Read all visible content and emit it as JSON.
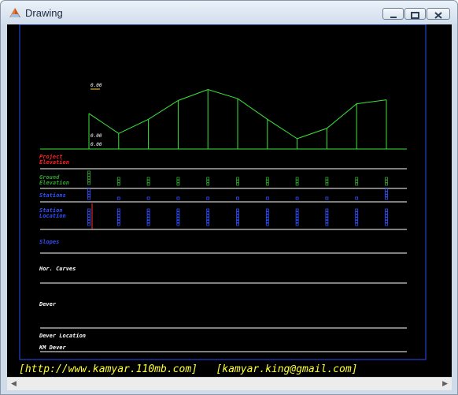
{
  "window": {
    "title": "Drawing"
  },
  "profile": {
    "elevation_labels": [
      "0.00",
      "0.00",
      "0.00"
    ],
    "profile_points": [
      {
        "station": 0,
        "elevation": 0.55
      },
      {
        "station": 1,
        "elevation": 0.24
      },
      {
        "station": 2,
        "elevation": 0.46
      },
      {
        "station": 3,
        "elevation": 0.75
      },
      {
        "station": 4,
        "elevation": 0.92
      },
      {
        "station": 5,
        "elevation": 0.78
      },
      {
        "station": 6,
        "elevation": 0.46
      },
      {
        "station": 7,
        "elevation": 0.16
      },
      {
        "station": 8,
        "elevation": 0.32
      },
      {
        "station": 9,
        "elevation": 0.7
      },
      {
        "station": 10,
        "elevation": 0.76
      }
    ]
  },
  "table_rows": {
    "project_elevation": [
      "Project",
      "Elevation"
    ],
    "ground_elevation": [
      "Ground",
      "Elevation"
    ],
    "stations": "Stations",
    "station_location": [
      "Station",
      "Location"
    ],
    "slopes": "Slopes",
    "hor_curves": "Hor. Curves",
    "dever": "Dever",
    "dever_location": "Dever Location",
    "km_dever": "KM Dever"
  },
  "row_colors": {
    "project_elevation": "#ff2020",
    "ground_elevation": "#2fa52f",
    "stations": "#3050ff",
    "station_location": "#3050ff",
    "slopes": "#3050ff",
    "hor_curves": "#ffffff",
    "dever": "#ffffff",
    "profile_line": "#39e639",
    "credits": "#ffff33",
    "frame": "#2a4fff"
  },
  "credits": "[http://www.kamyar.110mb.com]   [kamyar.king@gmail.com]"
}
